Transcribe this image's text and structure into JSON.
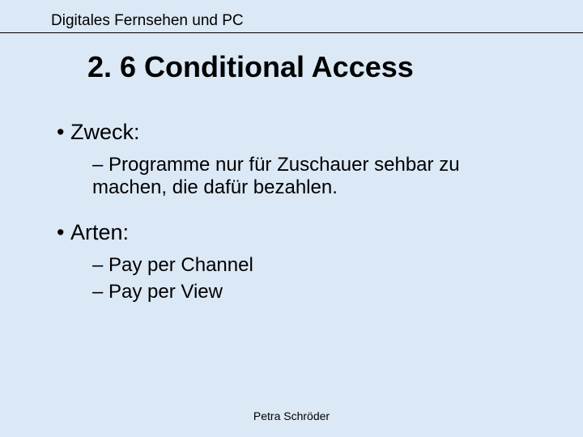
{
  "header": {
    "text": "Digitales Fernsehen und PC"
  },
  "title": "2. 6 Conditional Access",
  "content": {
    "items": [
      {
        "label": "Zweck:",
        "sub": [
          "Programme nur für Zuschauer sehbar zu machen, die dafür bezahlen."
        ]
      },
      {
        "label": "Arten:",
        "sub": [
          "Pay per Channel",
          "Pay per View"
        ]
      }
    ]
  },
  "footer": {
    "author": "Petra Schröder"
  }
}
